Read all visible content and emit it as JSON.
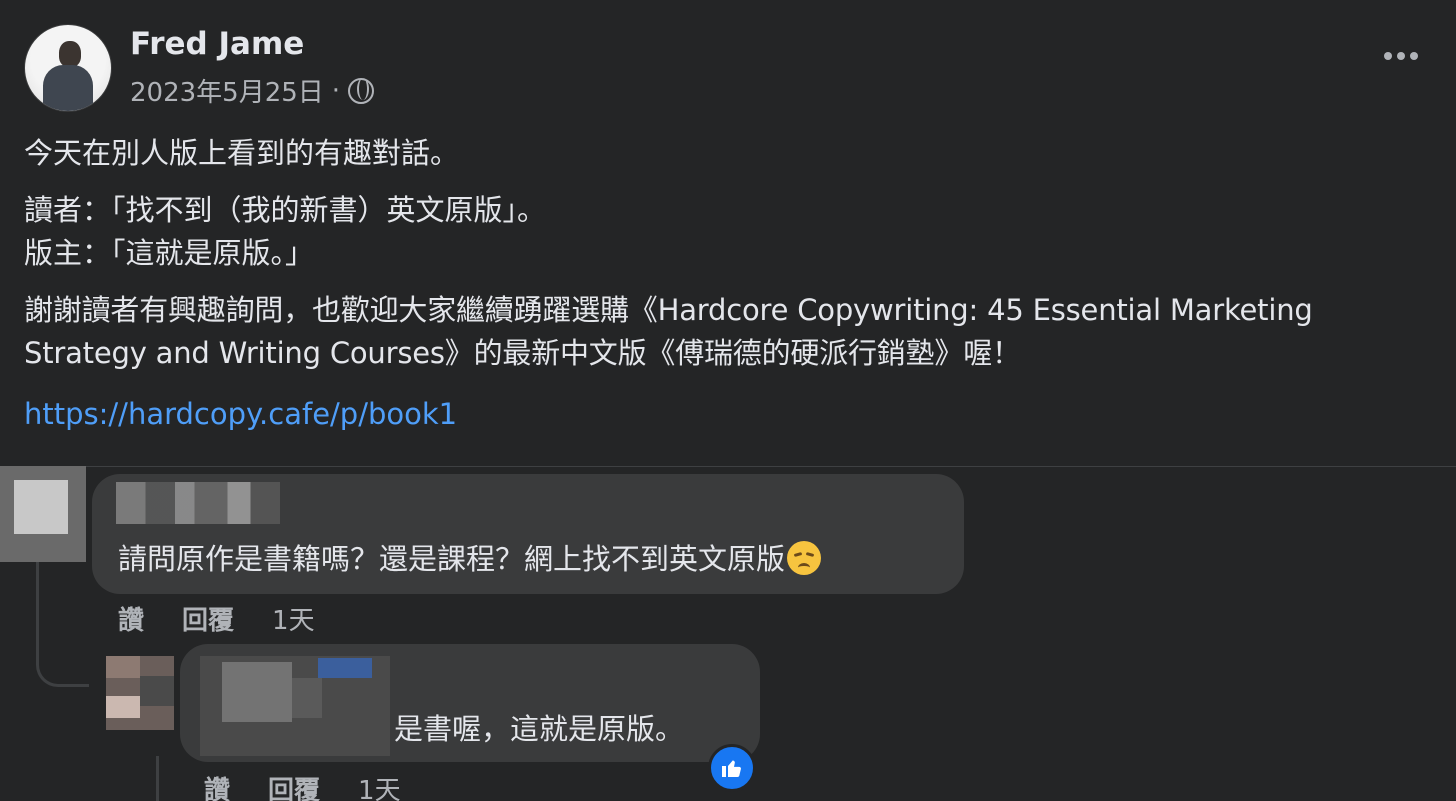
{
  "post": {
    "author": "Fred Jame",
    "date": "2023年5月25日",
    "meta_separator": "·",
    "visibility_icon": "globe-icon",
    "paragraph1": "今天在別人版上看到的有趣對話。",
    "dialog_line1": "讀者：「找不到（我的新書）英文原版」。",
    "dialog_line2": "版主：「這就是原版。」",
    "paragraph3_line1": "謝謝讀者有興趣詢問，也歡迎大家繼續踴躍選購《Hardcore Copywriting: 45 Essential Marketing",
    "paragraph3_line2": "Strategy and Writing Courses》的最新中文版《傅瑞德的硬派行銷塾》喔！",
    "link": "https://hardcopy.cafe/p/book1"
  },
  "comments": [
    {
      "text": "請問原作是書籍嗎？還是課程？網上找不到英文原版",
      "emoji": "disappointed-face-icon",
      "actions": {
        "like": "讚",
        "reply": "回覆",
        "time": "1天"
      }
    },
    {
      "text": "是書喔，這就是原版。",
      "reaction": "like-icon",
      "actions": {
        "like": "讚",
        "reply": "回覆",
        "time": "1天"
      }
    }
  ],
  "colors": {
    "background": "#242526",
    "bubble": "#3a3b3c",
    "link": "#4f9ef8",
    "like_badge": "#1877f2"
  }
}
